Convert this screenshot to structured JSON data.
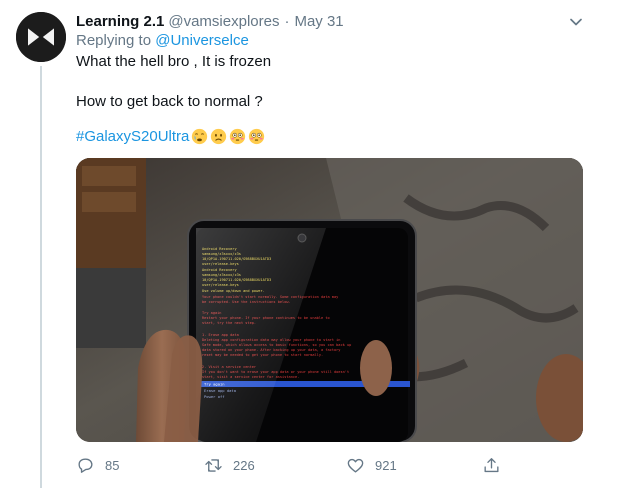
{
  "tweet": {
    "author_name": "Learning 2.1",
    "author_handle": "@vamsiexplores",
    "separator": "·",
    "date": "May 31",
    "replying_prefix": "Replying to",
    "replying_handle": "@Universelce",
    "line1": "What the hell bro , It is frozen",
    "line2": "How to get back to normal ?",
    "hashtag": "#GalaxyS20Ultra",
    "emojis": [
      "crying-face",
      "worried-face",
      "flushed-face",
      "flushed-face"
    ],
    "media": {
      "screen_text": [
        "Android Recovery",
        "samsung/z3sxxx/z3s",
        "10/QP1A.190711.020/G988BXXU1ATD3",
        "user/release-keys",
        "Android Recovery",
        "samsung/z3sxxx/z3s",
        "10/QP1A.190711.020/G988BXXU1ATD3",
        "user/release-keys",
        "Use volume up/down and power.",
        "Your phone couldn't start normally. Some configuration data may be corrupted.",
        "Try again",
        "Restart your phone. If your phone continues to be unable to start, try the next step.",
        "1. Erase app data",
        "Deleting app configuration data may allow your phone to start in Safe mode.",
        "2. Visit a service center",
        "If you don't want to erase your app data or your phone still doesn't start, visit a service center for assistance.",
        "Try again",
        "Erase app data",
        "Power off"
      ]
    }
  },
  "actions": {
    "reply_count": "85",
    "retweet_count": "226",
    "like_count": "921"
  },
  "colors": {
    "accent": "#1b95e0",
    "secondary_text": "#657786",
    "primary_text": "#0f1419",
    "thread_line": "#cfd9de",
    "recovery_red": "#e23c3c",
    "recovery_yellow": "#e8d34a",
    "recovery_selection": "#2a55d0"
  },
  "icons": {
    "avatar": "bowtie-logo",
    "caret": "chevron-down-icon",
    "reply": "speech-bubble-icon",
    "retweet": "retweet-arrows-icon",
    "like": "heart-icon",
    "share": "share-upload-icon"
  }
}
